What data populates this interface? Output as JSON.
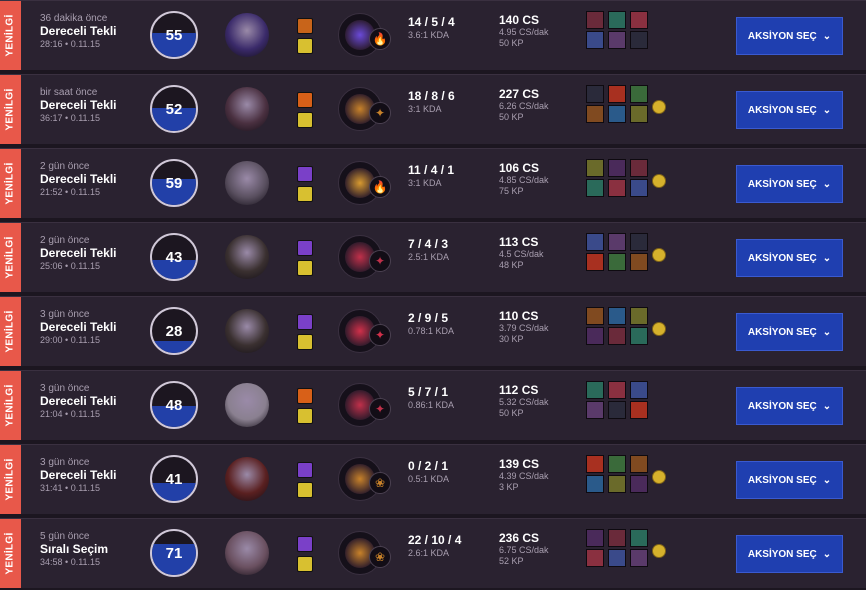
{
  "colors": {
    "loss_tag": "#e8584a",
    "row_bg": "#2a2230",
    "score_fill": "#2240a8",
    "button": "#1f3fb0"
  },
  "matches": [
    {
      "result": "YENİLGİ",
      "ago": "36 dakika önce",
      "queue": "Dereceli Tekli",
      "duration": "28:16",
      "patch": "0.11.15",
      "score": "55",
      "score_level": 0.55,
      "kda": "14 / 5 / 4",
      "kda_ratio": "3.6:1 KDA",
      "cs": "140 CS",
      "cs_per_min": "4.95 CS/dak",
      "kp": "50 KP",
      "action": "AKSİYON SEÇ",
      "champ_color": "#3a2a6a",
      "keystone_color": "#6a4ad8",
      "secondary_icon": "🔥",
      "ward": false
    },
    {
      "result": "YENİLGİ",
      "ago": "bir saat önce",
      "queue": "Dereceli Tekli",
      "duration": "36:17",
      "patch": "0.11.15",
      "score": "52",
      "score_level": 0.52,
      "kda": "18 / 8 / 6",
      "kda_ratio": "3:1 KDA",
      "cs": "227 CS",
      "cs_per_min": "6.26 CS/dak",
      "kp": "50 KP",
      "action": "AKSİYON SEÇ",
      "champ_color": "#4a3040",
      "keystone_color": "#c8822a",
      "secondary_icon": "✦",
      "ward": true
    },
    {
      "result": "YENİLGİ",
      "ago": "2 gün önce",
      "queue": "Dereceli Tekli",
      "duration": "21:52",
      "patch": "0.11.15",
      "score": "59",
      "score_level": 0.59,
      "kda": "11 / 4 / 1",
      "kda_ratio": "3:1 KDA",
      "cs": "106 CS",
      "cs_per_min": "4.85 CS/dak",
      "kp": "75 KP",
      "action": "AKSİYON SEÇ",
      "champ_color": "#5a5060",
      "keystone_color": "#d89a30",
      "secondary_icon": "🔥",
      "ward": true
    },
    {
      "result": "YENİLGİ",
      "ago": "2 gün önce",
      "queue": "Dereceli Tekli",
      "duration": "25:06",
      "patch": "0.11.15",
      "score": "43",
      "score_level": 0.43,
      "kda": "7 / 4 / 3",
      "kda_ratio": "2.5:1 KDA",
      "cs": "113 CS",
      "cs_per_min": "4.5 CS/dak",
      "kp": "48 KP",
      "action": "AKSİYON SEÇ",
      "champ_color": "#3a3030",
      "keystone_color": "#c0304a",
      "secondary_icon": "✦",
      "ward": true
    },
    {
      "result": "YENİLGİ",
      "ago": "3 gün önce",
      "queue": "Dereceli Tekli",
      "duration": "29:00",
      "patch": "0.11.15",
      "score": "28",
      "score_level": 0.28,
      "kda": "2 / 9 / 5",
      "kda_ratio": "0.78:1 KDA",
      "cs": "110 CS",
      "cs_per_min": "3.79 CS/dak",
      "kp": "30 KP",
      "action": "AKSİYON SEÇ",
      "champ_color": "#3a3030",
      "keystone_color": "#d0304a",
      "secondary_icon": "✦",
      "ward": true
    },
    {
      "result": "YENİLGİ",
      "ago": "3 gün önce",
      "queue": "Dereceli Tekli",
      "duration": "21:04",
      "patch": "0.11.15",
      "score": "48",
      "score_level": 0.48,
      "kda": "5 / 7 / 1",
      "kda_ratio": "0.86:1 KDA",
      "cs": "112 CS",
      "cs_per_min": "5.32 CS/dak",
      "kp": "50 KP",
      "action": "AKSİYON SEÇ",
      "champ_color": "#8a8090",
      "keystone_color": "#c0304a",
      "secondary_icon": "✦",
      "ward": false
    },
    {
      "result": "YENİLGİ",
      "ago": "3 gün önce",
      "queue": "Dereceli Tekli",
      "duration": "31:41",
      "patch": "0.11.15",
      "score": "41",
      "score_level": 0.41,
      "kda": "0 / 2 / 1",
      "kda_ratio": "0.5:1 KDA",
      "cs": "139 CS",
      "cs_per_min": "4.39 CS/dak",
      "kp": "3 KP",
      "action": "AKSİYON SEÇ",
      "champ_color": "#5a2020",
      "keystone_color": "#c8822a",
      "secondary_icon": "❀",
      "ward": true
    },
    {
      "result": "YENİLGİ",
      "ago": "5 gün önce",
      "queue": "Sıralı Seçim",
      "duration": "34:58",
      "patch": "0.11.15",
      "score": "71",
      "score_level": 0.71,
      "kda": "22 / 10 / 4",
      "kda_ratio": "2.6:1 KDA",
      "cs": "236 CS",
      "cs_per_min": "6.75 CS/dak",
      "kp": "52 KP",
      "action": "AKSİYON SEÇ",
      "champ_color": "#6a5060",
      "keystone_color": "#c8822a",
      "secondary_icon": "❀",
      "ward": true
    }
  ]
}
